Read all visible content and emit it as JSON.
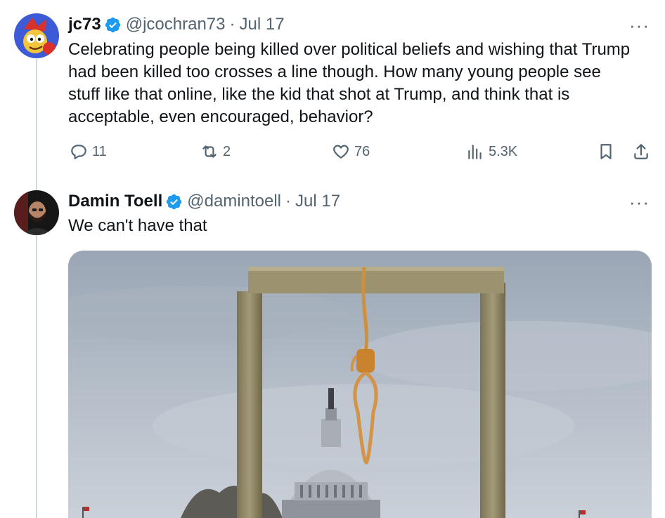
{
  "tweets": [
    {
      "name": "jc73",
      "handle": "@jcochran73",
      "separator": "·",
      "date": "Jul 17",
      "text": "Celebrating people being killed over political beliefs and wishing that Trump\nhad been killed too crosses a line though.  How many young people see\nstuff like that online, like the kid that shot at Trump, and think that is\nacceptable, even encouraged, behavior?",
      "more": "···",
      "stats": {
        "replies": "11",
        "reposts": "2",
        "likes": "76",
        "views": "5.3K"
      }
    },
    {
      "name": "Damin Toell",
      "handle": "@damintoell",
      "separator": "·",
      "date": "Jul 17",
      "text": "We can't have that",
      "more": "···"
    }
  ],
  "colors": {
    "verified_badge": "#1d9bf0",
    "secondary_text": "#536471",
    "thread_line": "#cfd9de"
  },
  "icons": [
    "verified-badge-icon",
    "more-icon",
    "reply-icon",
    "repost-icon",
    "like-icon",
    "views-icon",
    "bookmark-icon",
    "share-icon"
  ]
}
